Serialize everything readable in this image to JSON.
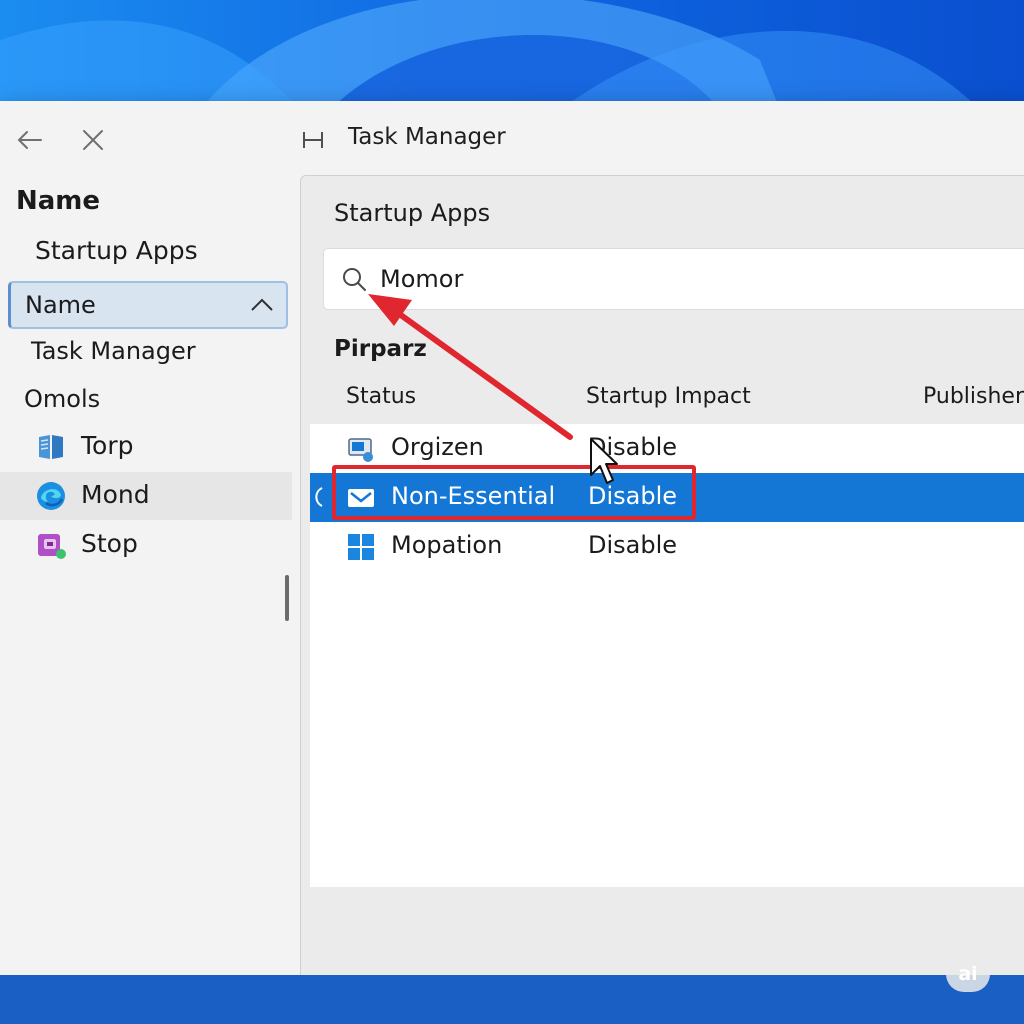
{
  "window": {
    "title": "Task Manager"
  },
  "sidebar": {
    "heading": "Name",
    "subheading": "Startup Apps",
    "sort_label": "Name",
    "task_manager_label": "Task Manager",
    "section_label": "Omols",
    "items": [
      {
        "label": "Torp",
        "icon": "book-icon"
      },
      {
        "label": "Mond",
        "icon": "edge-icon"
      },
      {
        "label": "Stop",
        "icon": "app-box-icon"
      }
    ]
  },
  "main": {
    "title": "Startup Apps",
    "search": {
      "value": "Momor"
    },
    "group_label": "Pirparz",
    "columns": [
      "Status",
      "Startup Impact",
      "Publisher"
    ],
    "rows": [
      {
        "name": "Orgizen",
        "status": "Disable",
        "icon": "monitor-icon"
      },
      {
        "name": "Non-Essential",
        "status": "Disable",
        "icon": "mail-icon"
      },
      {
        "name": "Mopation",
        "status": "Disable",
        "icon": "windows-icon"
      }
    ],
    "selected_row": "Non-Essential"
  },
  "badge": {
    "text": "ai"
  },
  "colors": {
    "accent": "#1477d6",
    "annotation": "#e0262e",
    "window_bg": "#f3f3f3"
  }
}
